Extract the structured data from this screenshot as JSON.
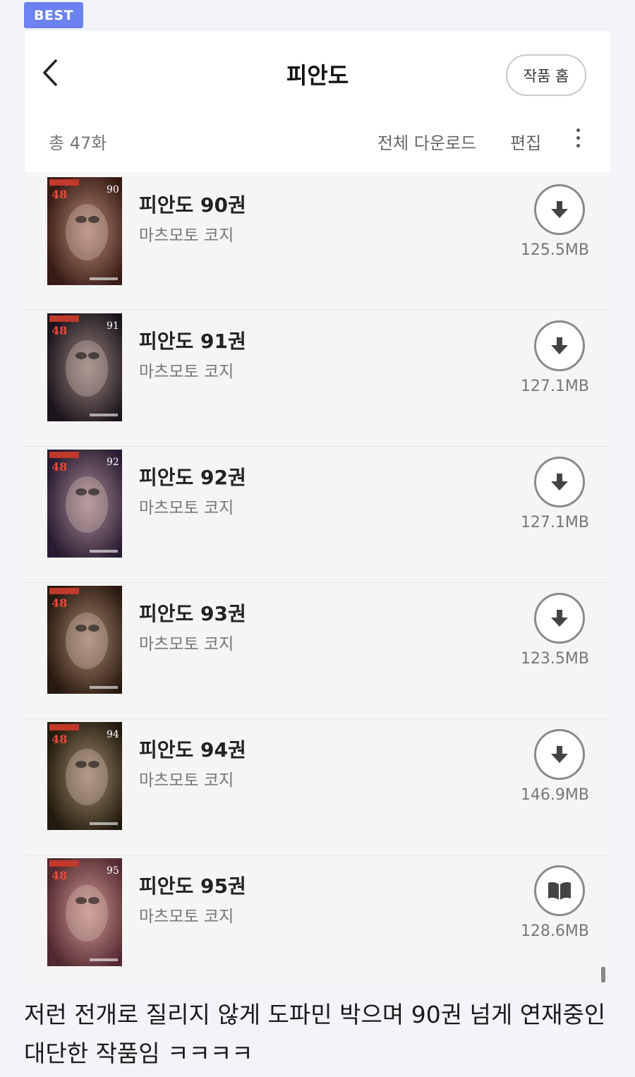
{
  "badge": "BEST",
  "header": {
    "title": "피안도",
    "home_label": "작품 홈",
    "back_icon": "chevron-left-icon"
  },
  "toolbar": {
    "total": "총 47화",
    "download_all": "전체 다운로드",
    "edit": "편집",
    "more_icon": "more-vertical-icon"
  },
  "volumes": [
    {
      "title": "피안도 90권",
      "author": "마츠모토 코지",
      "size": "125.5MB",
      "action_icon": "download-icon",
      "cover_number": "90",
      "cover_color": "#7a3b2e"
    },
    {
      "title": "피안도 91권",
      "author": "마츠모토 코지",
      "size": "127.1MB",
      "action_icon": "download-icon",
      "cover_number": "91",
      "cover_color": "#3a2d3e"
    },
    {
      "title": "피안도 92권",
      "author": "마츠모토 코지",
      "size": "127.1MB",
      "action_icon": "download-icon",
      "cover_number": "92",
      "cover_color": "#5b3d6e"
    },
    {
      "title": "피안도 93권",
      "author": "마츠모토 코지",
      "size": "123.5MB",
      "action_icon": "download-icon",
      "cover_number": "",
      "cover_color": "#5a3722"
    },
    {
      "title": "피안도 94권",
      "author": "마츠모토 코지",
      "size": "146.9MB",
      "action_icon": "download-icon",
      "cover_number": "94",
      "cover_color": "#4a3a1c"
    },
    {
      "title": "피안도 95권",
      "author": "마츠모토 코지",
      "size": "128.6MB",
      "action_icon": "book-open-icon",
      "cover_number": "95",
      "cover_color": "#b55b6b"
    }
  ],
  "caption": "저런 전개로 질리지 않게 도파민 박으며 90권 넘게 연재중인 대단한 작품임 ㅋㅋㅋㅋ",
  "colors": {
    "badge": "#6b82f0",
    "row_bg": "#f5f5f5",
    "page_bg": "#f3f4f9"
  }
}
